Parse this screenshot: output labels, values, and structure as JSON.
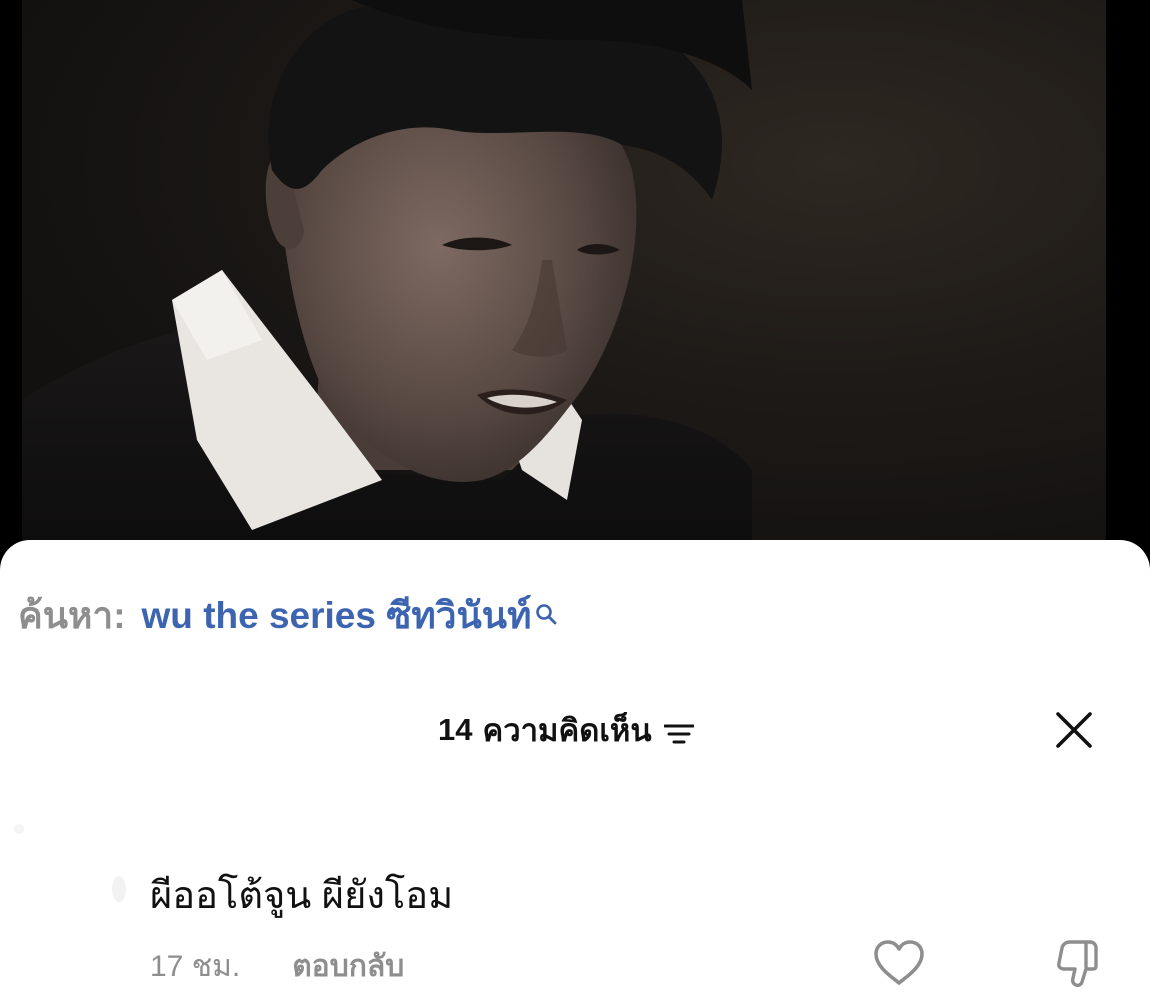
{
  "video": {
    "description_icon": "video-frame"
  },
  "search": {
    "prefix": "ค้นหา:",
    "query": "wu the series ซีทวินันท์",
    "icon": "search-icon"
  },
  "comments_header": {
    "count": "14",
    "label": "ความคิดเห็น",
    "filter_icon": "filter-icon",
    "close_icon": "close-icon"
  },
  "comment": {
    "text": "ผีออโต้จูน ผียังโอม",
    "time": "17 ชม.",
    "reply_label": "ตอบกลับ",
    "like_icon": "heart-icon",
    "dislike_icon": "thumbs-down-icon"
  },
  "colors": {
    "link_blue": "#3c64b0",
    "muted_gray": "#8e8e8e",
    "text_dark": "#111111"
  }
}
